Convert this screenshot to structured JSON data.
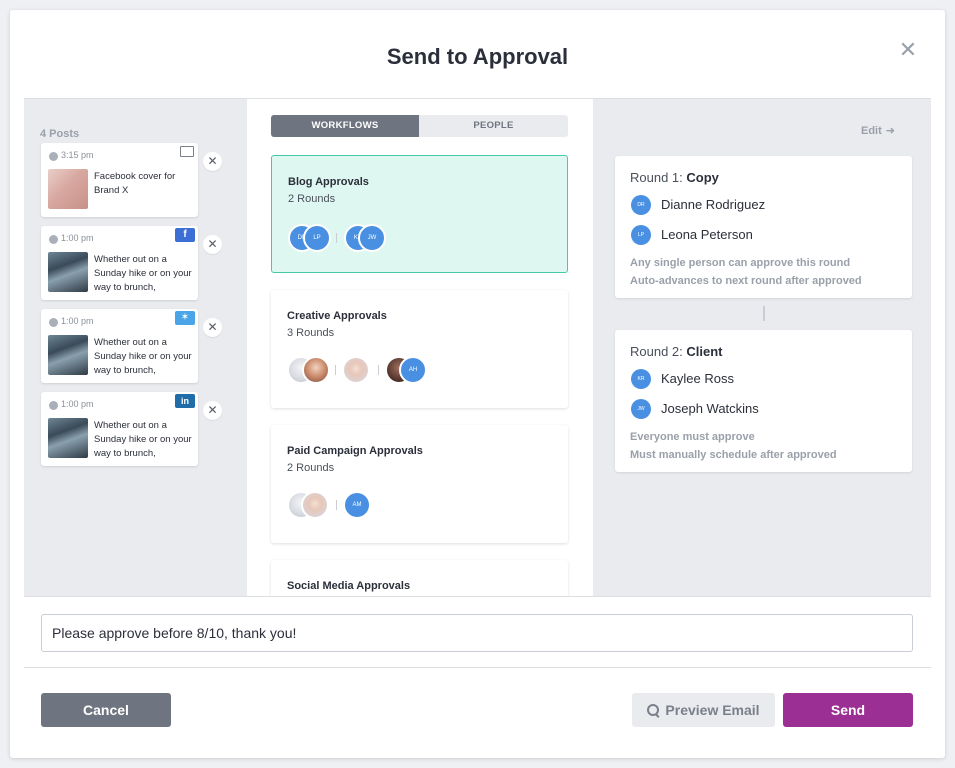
{
  "modal": {
    "title": "Send to Approval"
  },
  "posts": {
    "count_label": "4 Posts",
    "items": [
      {
        "time": "3:15 pm",
        "network": "image",
        "text": "Facebook cover for Brand X"
      },
      {
        "time": "1:00 pm",
        "network": "facebook",
        "text": "Whether out on a Sunday hike or on your way to brunch,"
      },
      {
        "time": "1:00 pm",
        "network": "twitter",
        "text": "Whether out on a Sunday hike or on your way to brunch,"
      },
      {
        "time": "1:00 pm",
        "network": "linkedin",
        "text": "Whether out on a Sunday hike or on your way to brunch,"
      }
    ]
  },
  "tabs": {
    "workflows": "WORKFLOWS",
    "people": "PEOPLE"
  },
  "workflows": [
    {
      "name": "Blog Approvals",
      "rounds": "2 Rounds",
      "avatars": [
        "DR",
        "LP",
        "KR",
        "JW"
      ]
    },
    {
      "name": "Creative Approvals",
      "rounds": "3 Rounds",
      "avatars": [
        "AH"
      ]
    },
    {
      "name": "Paid Campaign Approvals",
      "rounds": "2 Rounds",
      "avatars": [
        "AM"
      ]
    },
    {
      "name": "Social Media Approvals",
      "rounds": "",
      "avatars": []
    }
  ],
  "detail": {
    "edit_label": "Edit",
    "rounds": [
      {
        "label": "Round 1:",
        "name": "Copy",
        "members": [
          {
            "initials": "DR",
            "name": "Dianne Rodriguez"
          },
          {
            "initials": "LP",
            "name": "Leona Peterson"
          }
        ],
        "notes": [
          "Any single person can approve this round",
          "Auto-advances to next round after approved"
        ]
      },
      {
        "label": "Round 2:",
        "name": "Client",
        "members": [
          {
            "initials": "KR",
            "name": "Kaylee Ross"
          },
          {
            "initials": "JW",
            "name": "Joseph Watckins"
          }
        ],
        "notes": [
          "Everyone must approve",
          "Must manually schedule after approved"
        ]
      }
    ]
  },
  "message": {
    "value": "Please approve before 8/10, thank you!"
  },
  "footer": {
    "cancel": "Cancel",
    "preview": "Preview Email",
    "send": "Send"
  },
  "colors": {
    "accent": "#9b2f94",
    "selected_bg": "#dff7f1",
    "selected_border": "#46c9a4",
    "avatar_blue": "#4a90e2"
  }
}
